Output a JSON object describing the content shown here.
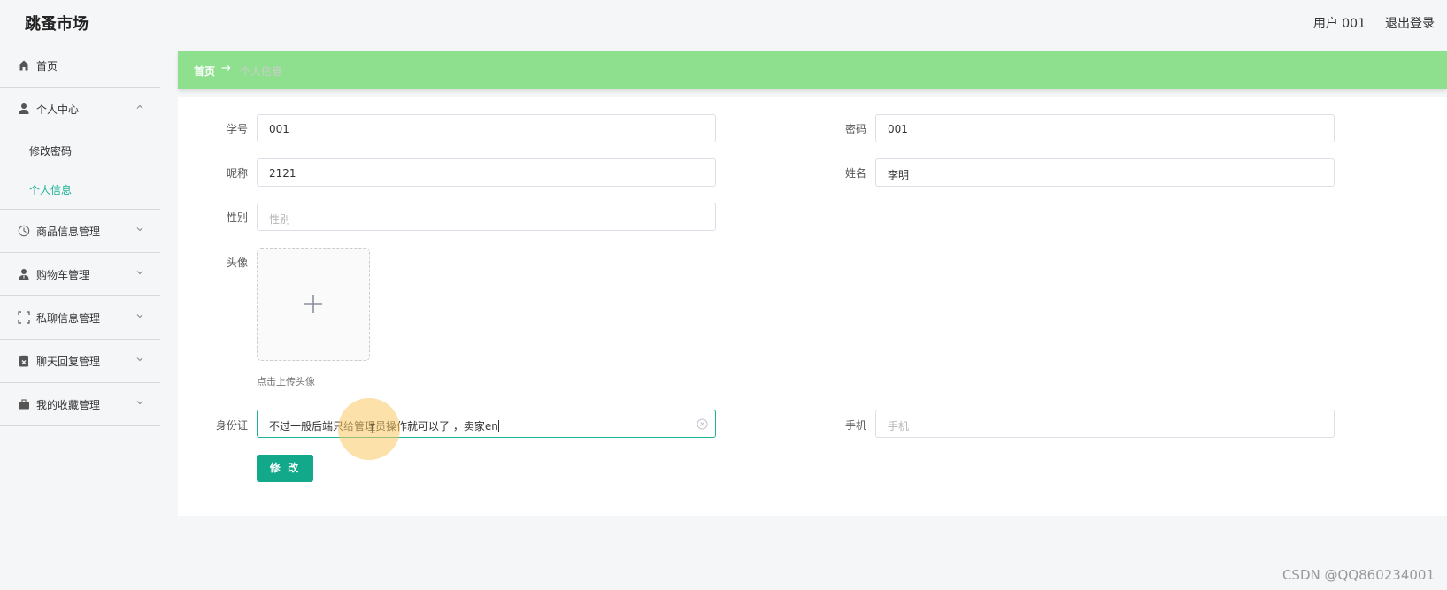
{
  "header": {
    "app_title": "跳蚤市场",
    "user_label": "用户 001",
    "logout_label": "退出登录"
  },
  "sidebar": {
    "items": [
      {
        "label": "首页",
        "icon": "home-icon"
      },
      {
        "label": "个人中心",
        "icon": "user-icon",
        "expanded": true,
        "children": [
          {
            "label": "修改密码"
          },
          {
            "label": "个人信息",
            "active": true
          }
        ]
      },
      {
        "label": "商品信息管理",
        "icon": "clock-icon"
      },
      {
        "label": "购物车管理",
        "icon": "user-tie-icon"
      },
      {
        "label": "私聊信息管理",
        "icon": "fullscreen-icon"
      },
      {
        "label": "聊天回复管理",
        "icon": "clipboard-x-icon"
      },
      {
        "label": "我的收藏管理",
        "icon": "suitcase-icon"
      }
    ]
  },
  "breadcrumb": {
    "home": "首页",
    "separator": "→",
    "current": "个人信息"
  },
  "form": {
    "student_id": {
      "label": "学号",
      "value": "001"
    },
    "password": {
      "label": "密码",
      "value": "001"
    },
    "nickname": {
      "label": "昵称",
      "value": "2121"
    },
    "name": {
      "label": "姓名",
      "value": "李明"
    },
    "gender": {
      "label": "性别",
      "placeholder": "性别"
    },
    "avatar": {
      "label": "头像",
      "hint": "点击上传头像"
    },
    "id_card": {
      "label": "身份证",
      "value": "不过一般后端只给管理员操作就可以了 ，卖家en"
    },
    "phone": {
      "label": "手机",
      "placeholder": "手机"
    },
    "submit_label": "修 改"
  },
  "watermark": "CSDN @QQ860234001",
  "colors": {
    "accent": "#1ab394",
    "breadcrumb_bg": "#8ee08e",
    "button_bg": "#12a88a"
  }
}
